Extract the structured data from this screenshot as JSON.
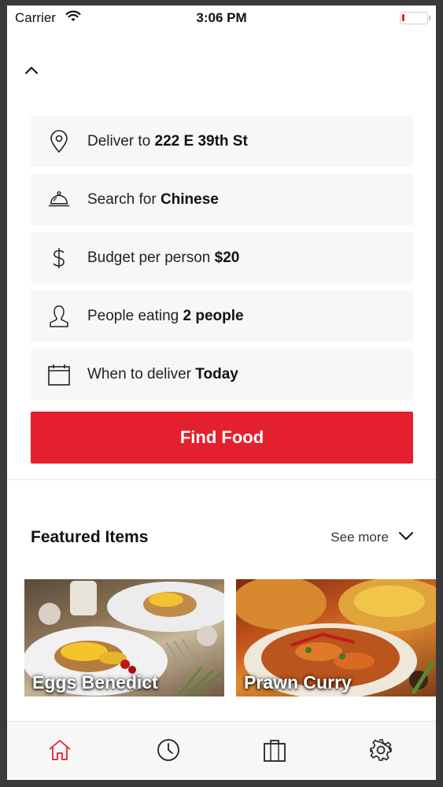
{
  "status_bar": {
    "carrier": "Carrier",
    "time": "3:06 PM",
    "battery_level": 0.1
  },
  "colors": {
    "accent": "#e5202e",
    "row_bg": "#f7f7f8",
    "text": "#222222"
  },
  "filters": [
    {
      "icon": "location-pin-icon",
      "label": "Deliver to ",
      "value": "222 E 39th St"
    },
    {
      "icon": "food-cloche-icon",
      "label": "Search for ",
      "value": "Chinese"
    },
    {
      "icon": "dollar-icon",
      "label": "Budget per person ",
      "value": "$20"
    },
    {
      "icon": "person-icon",
      "label": "People eating ",
      "value": "2 people"
    },
    {
      "icon": "calendar-icon",
      "label": "When to deliver ",
      "value": "Today"
    }
  ],
  "find_button": {
    "label": "Find Food"
  },
  "featured": {
    "title": "Featured Items",
    "see_more": "See more",
    "items": [
      {
        "name": "Eggs Benedict"
      },
      {
        "name": "Prawn Curry"
      }
    ]
  },
  "tab_bar": {
    "tabs": [
      {
        "icon": "home-icon",
        "active": true
      },
      {
        "icon": "clock-icon",
        "active": false
      },
      {
        "icon": "shopping-bag-icon",
        "active": false
      },
      {
        "icon": "gear-icon",
        "active": false
      }
    ]
  }
}
